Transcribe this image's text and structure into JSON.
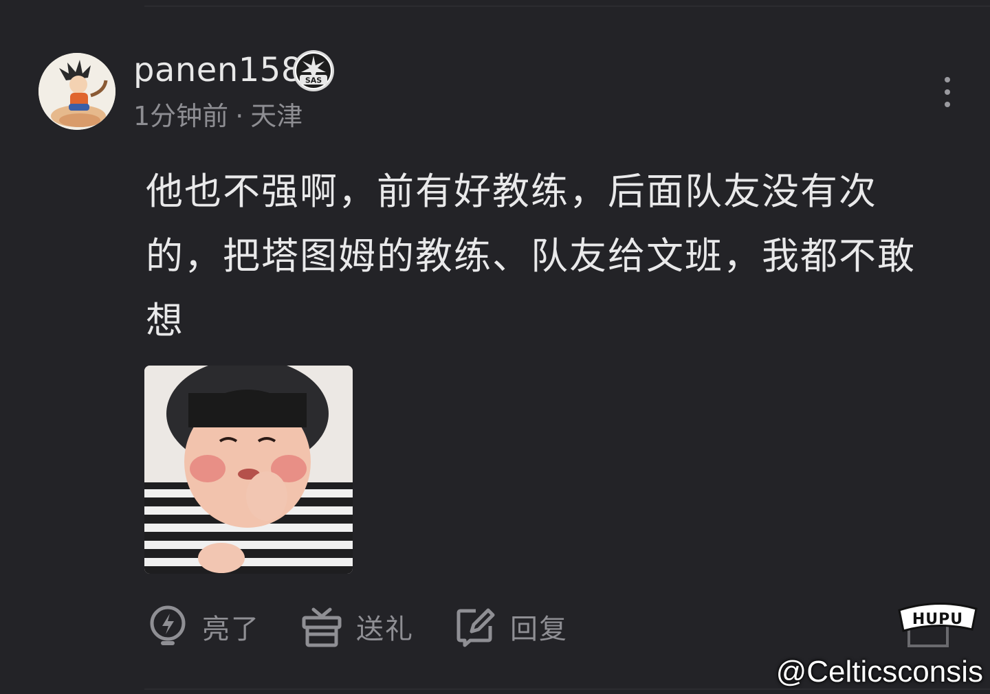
{
  "comment": {
    "username": "panen158",
    "badge_team": "SAS",
    "time_ago": "1分钟前",
    "separator": "·",
    "location": "天津",
    "text": "他也不强啊，前有好教练，后面队友没有次的，把塔图姆的教练、队友给文班，我都不敢想",
    "avatar_icon": "cartoon-avatar",
    "image_icon": "child-meme-photo"
  },
  "actions": {
    "light_label": "亮了",
    "gift_label": "送礼",
    "reply_label": "回复"
  },
  "branding": {
    "logo_text": "HUPU",
    "watermark": "@Celticsconsis"
  },
  "colors": {
    "background": "#232327",
    "text": "#e9e9ea",
    "muted": "#8e8e93"
  }
}
